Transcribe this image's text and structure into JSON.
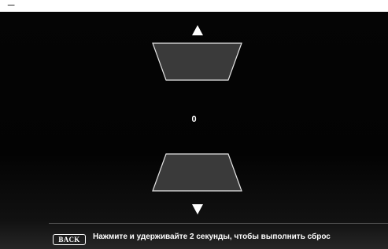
{
  "top_strip_text": "_",
  "keystone": {
    "value": "0",
    "up_icon": "triangle-up",
    "down_icon": "triangle-down"
  },
  "footer": {
    "back_key_label": "BACK",
    "hint": "Нажмите и удерживайте 2 секунды, чтобы выполнить сброс"
  },
  "colors": {
    "background": "#000000",
    "shape_fill": "#3a3a3a",
    "shape_stroke": "#e6e6e6",
    "text": "#ffffff"
  }
}
